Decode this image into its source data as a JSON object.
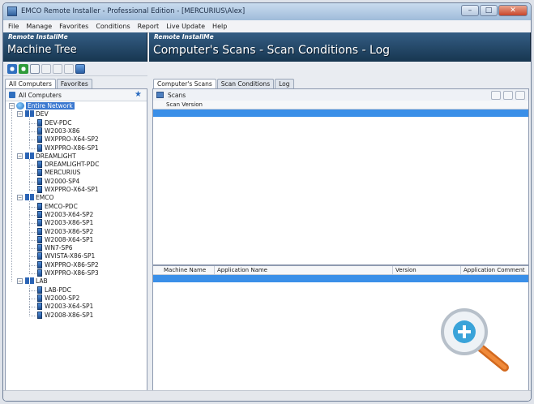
{
  "window": {
    "title": "EMCO Remote Installer - Professional Edition - [MERCURIUS\\Alex]",
    "buttons": {
      "minimize": "–",
      "maximize": "□",
      "close": "✕"
    }
  },
  "menu": [
    "File",
    "Manage",
    "Favorites",
    "Conditions",
    "Report",
    "Live Update",
    "Help"
  ],
  "left_banner": {
    "brand": "Remote InstallMe",
    "title": "Machine Tree"
  },
  "right_banner": {
    "brand": "Remote InstallMe",
    "title": "Computer's Scans - Scan Conditions - Log"
  },
  "left_tabs": [
    "All Computers",
    "Favorites"
  ],
  "all_computers_label": "All Computers",
  "tree": {
    "root": "Entire Network",
    "groups": [
      {
        "name": "DEV",
        "items": [
          "DEV-PDC",
          "W2003-X86",
          "WXPPRO-X64-SP2",
          "WXPPRO-X86-SP1"
        ]
      },
      {
        "name": "DREAMLIGHT",
        "items": [
          "DREAMLIGHT-PDC",
          "MERCURIUS",
          "W2000-SP4",
          "WXPPRO-X64-SP1"
        ]
      },
      {
        "name": "EMCO",
        "items": [
          "EMCO-PDC",
          "W2003-X64-SP2",
          "W2003-X86-SP1",
          "W2003-X86-SP2",
          "W2008-X64-SP1",
          "WN7-SP6",
          "WVISTA-X86-SP1",
          "WXPPRO-X86-SP2",
          "WXPPRO-X86-SP3"
        ]
      },
      {
        "name": "LAB",
        "items": [
          "LAB-PDC",
          "W2000-SP2",
          "W2003-X64-SP1",
          "W2008-X86-SP1"
        ]
      }
    ]
  },
  "right_tabs": [
    "Computer's Scans",
    "Scan Conditions",
    "Log"
  ],
  "scans": {
    "label": "Scans",
    "column": "Scan Version"
  },
  "apps_columns": [
    "Machine Name",
    "Application Name",
    "Version",
    "Application Comment"
  ],
  "colors": {
    "banner": "#1f4263",
    "selection": "#3a8fe8",
    "accent": "#2c6cc0"
  }
}
